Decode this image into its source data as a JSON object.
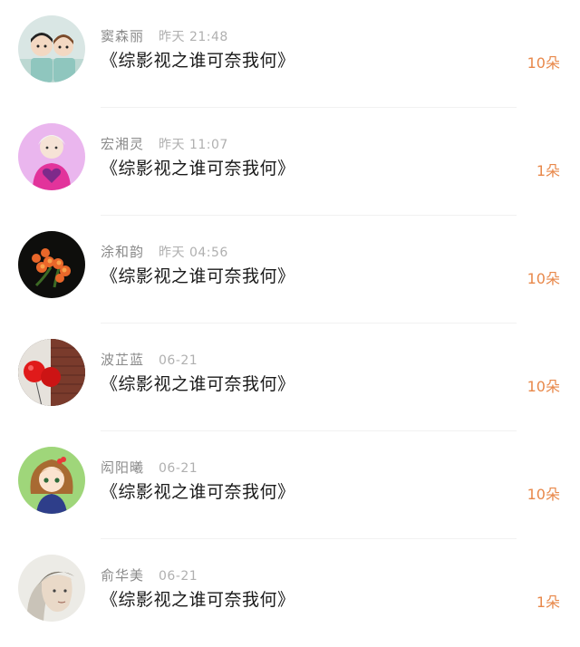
{
  "gifts": [
    {
      "name": "窦森丽",
      "time": "昨天 21:48",
      "book": "《综影视之谁可奈我何》",
      "count": "10朵",
      "avatar_icon": "boys-avatar-icon"
    },
    {
      "name": "宏湘灵",
      "time": "昨天 11:07",
      "book": "《综影视之谁可奈我何》",
      "count": "1朵",
      "avatar_icon": "pink-heart-girl-avatar-icon"
    },
    {
      "name": "涂和韵",
      "time": "昨天 04:56",
      "book": "《综影视之谁可奈我何》",
      "count": "10朵",
      "avatar_icon": "orange-flowers-avatar-icon"
    },
    {
      "name": "波芷蓝",
      "time": "06-21",
      "book": "《综影视之谁可奈我何》",
      "count": "10朵",
      "avatar_icon": "red-balloons-avatar-icon"
    },
    {
      "name": "闳阳曦",
      "time": "06-21",
      "book": "《综影视之谁可奈我何》",
      "count": "10朵",
      "avatar_icon": "anime-girl-avatar-icon"
    },
    {
      "name": "俞华美",
      "time": "06-21",
      "book": "《综影视之谁可奈我何》",
      "count": "1朵",
      "avatar_icon": "sketch-portrait-avatar-icon"
    }
  ],
  "colors": {
    "accent": "#e8884a",
    "name": "#8a8a8a",
    "time": "#b0b0b0",
    "title": "#1a1a1a"
  }
}
